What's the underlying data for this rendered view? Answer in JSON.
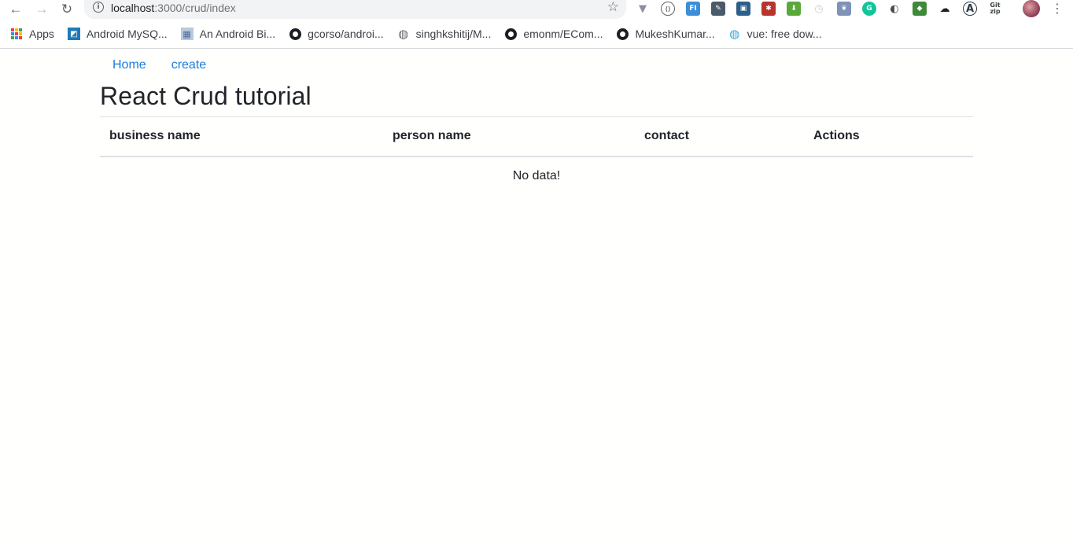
{
  "browser": {
    "url_host": "localhost",
    "url_path": ":3000/crud/index",
    "extensions": [
      {
        "name": "vuejs-devtools-icon",
        "color": "#8a9099",
        "glyph": "▼"
      },
      {
        "name": "code-extension-icon",
        "color": "#5f6368",
        "glyph": "⟨⟩"
      },
      {
        "name": "fi-extension-icon",
        "color": "#3a8fd8",
        "glyph": "FI"
      },
      {
        "name": "eyedropper-extension-icon",
        "color": "#4a5a6a",
        "glyph": "✎"
      },
      {
        "name": "briefcase-extension-icon",
        "color": "#2c5f8a",
        "glyph": "▣"
      },
      {
        "name": "red-extension-icon",
        "color": "#b8342c",
        "glyph": "✱"
      },
      {
        "name": "download-extension-icon",
        "color": "#5aa83a",
        "glyph": "⬇"
      },
      {
        "name": "timer-extension-icon",
        "color": "#c9cdd2",
        "glyph": "◷"
      },
      {
        "name": "feather-extension-icon",
        "color": "#7f93b8",
        "glyph": "❦"
      },
      {
        "name": "grammarly-icon",
        "color": "#15c39a",
        "glyph": "G"
      },
      {
        "name": "dark-reader-icon",
        "color": "#4a4d52",
        "glyph": "◐"
      },
      {
        "name": "cube-extension-icon",
        "color": "#3f8a3a",
        "glyph": "◆"
      },
      {
        "name": "cloud-extension-icon",
        "color": "#202124",
        "glyph": "☁"
      },
      {
        "name": "a-extension-icon",
        "color": "#2f3a4a",
        "glyph": "A"
      },
      {
        "name": "gitzip-extension-icon",
        "color": "#3c4043",
        "glyph": "Git"
      }
    ]
  },
  "bookmarks": {
    "apps_label": "Apps",
    "items": [
      {
        "label": "Android MySQ...",
        "icon": "android-mysql-favicon"
      },
      {
        "label": "An Android Bi...",
        "icon": "calendar-favicon"
      },
      {
        "label": "gcorso/androi...",
        "icon": "github-icon"
      },
      {
        "label": "singhkshitij/M...",
        "icon": "globe-icon"
      },
      {
        "label": "emonm/ECom...",
        "icon": "github-icon"
      },
      {
        "label": "MukeshKumar...",
        "icon": "github-icon"
      },
      {
        "label": "vue: free dow...",
        "icon": "globe-blue-icon"
      }
    ]
  },
  "nav": {
    "home": "Home",
    "create": "create"
  },
  "page": {
    "title": "React Crud tutorial",
    "columns": [
      "business name",
      "person name",
      "contact",
      "Actions"
    ],
    "empty_message": "No data!"
  },
  "colors": {
    "link": "#1a7de0",
    "text": "#212529",
    "border": "#dee2e6"
  }
}
